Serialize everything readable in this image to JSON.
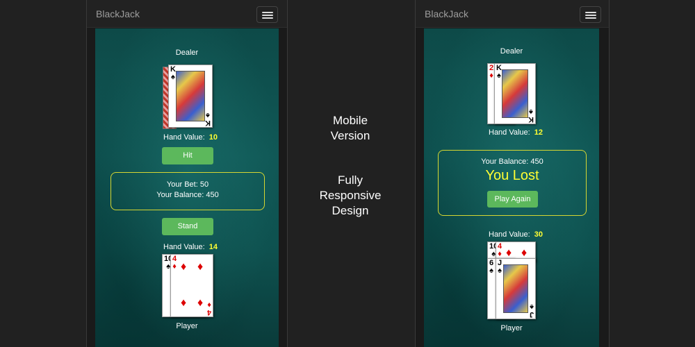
{
  "mobile_left": {
    "brand": "BlackJack",
    "dealer_label": "Dealer",
    "dealer_hand_label": "Hand Value:",
    "dealer_hand_value": "10",
    "hit_label": "Hit",
    "bet_text": "Your Bet: 50",
    "balance_text": "Your Balance: 450",
    "stand_label": "Stand",
    "player_hand_label": "Hand Value:",
    "player_hand_value": "14",
    "player_label": "Player",
    "dealer_cards": [
      {
        "rank": "K",
        "suit": "♠"
      }
    ],
    "player_cards": [
      {
        "rank": "10",
        "suit": "♠"
      },
      {
        "rank": "4",
        "suit": "♦"
      }
    ]
  },
  "center_text": {
    "line1": "Mobile",
    "line2": "Version",
    "line3": "Fully",
    "line4": "Responsive",
    "line5": "Design"
  },
  "mobile_right": {
    "brand": "BlackJack",
    "dealer_label": "Dealer",
    "dealer_hand_label": "Hand Value:",
    "dealer_hand_value": "12",
    "balance_text": "Your Balance: 450",
    "result_text": "You Lost",
    "play_again_label": "Play Again",
    "player_hand_label": "Hand Value:",
    "player_hand_value": "30",
    "player_label": "Player",
    "dealer_cards": [
      {
        "rank": "2",
        "suit": "♦"
      },
      {
        "rank": "K",
        "suit": "♠"
      }
    ],
    "player_cards": [
      {
        "rank": "10",
        "suit": "♠"
      },
      {
        "rank": "4",
        "suit": "♦"
      },
      {
        "rank": "6",
        "suit": "♠"
      },
      {
        "rank": "J",
        "suit": "♠"
      }
    ]
  },
  "colors": {
    "accent_green": "#5cb85c",
    "highlight_yellow": "#ffff33",
    "felt": "#105856"
  }
}
